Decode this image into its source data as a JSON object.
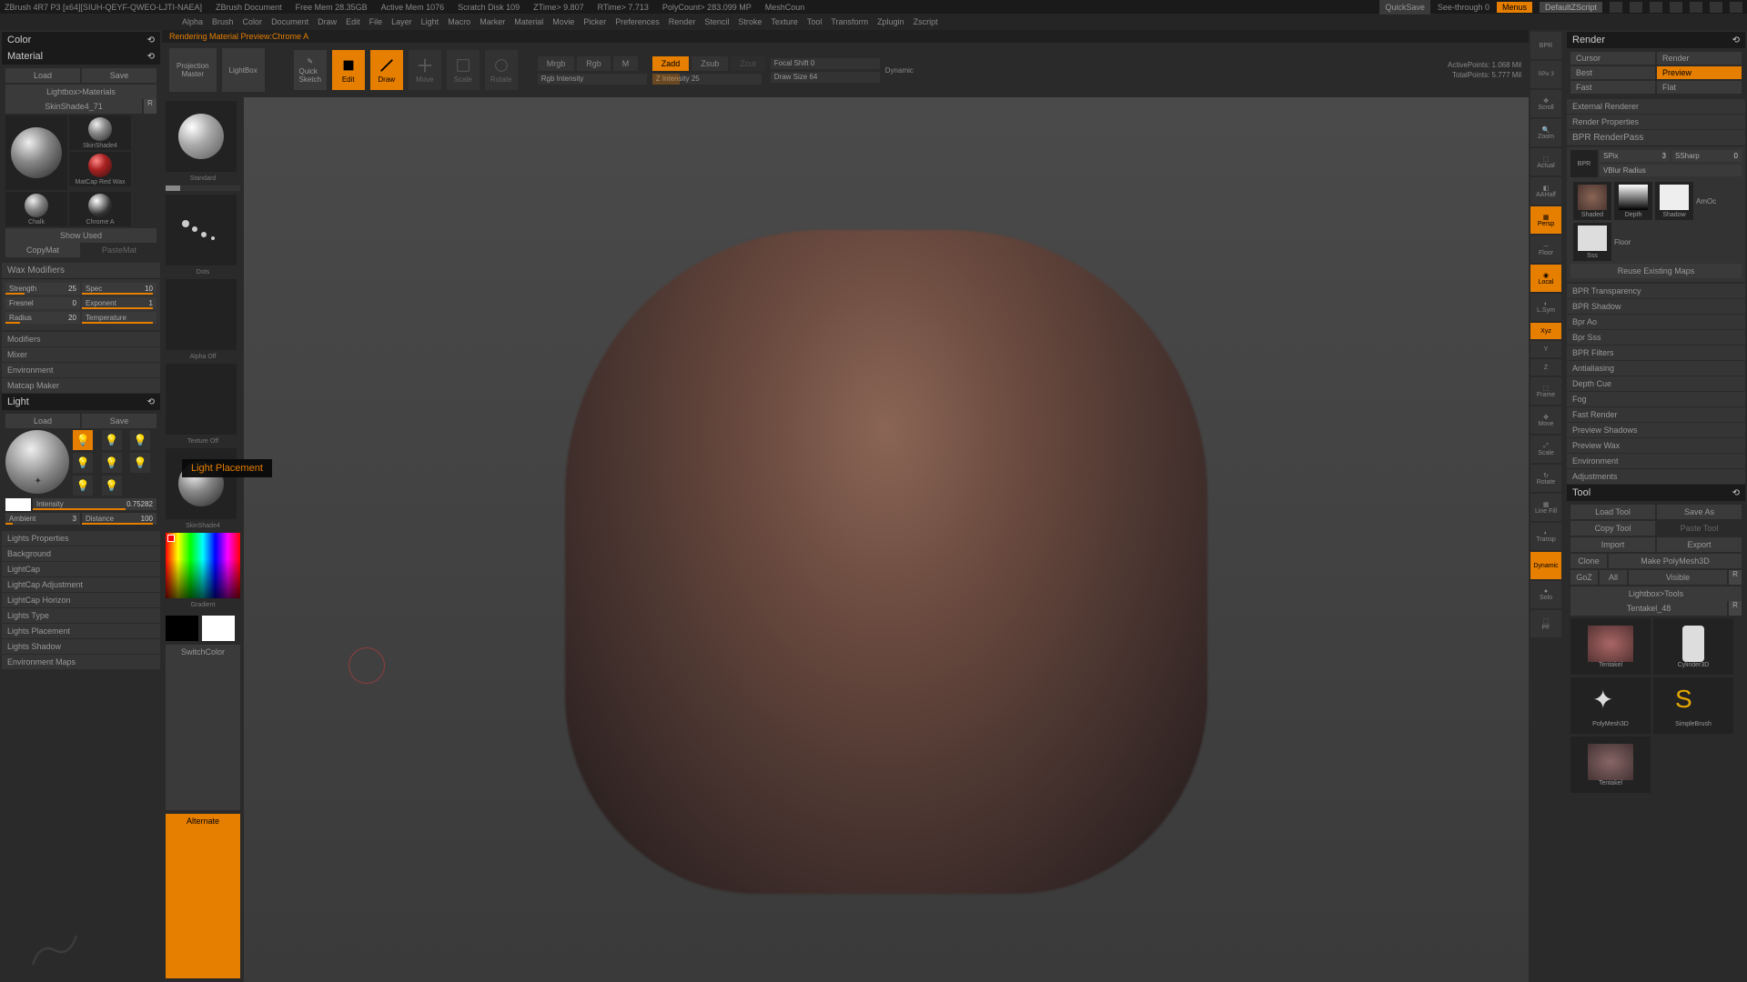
{
  "titlebar": {
    "app": "ZBrush 4R7 P3 [x64][SIUH-QEYF-QWEO-LJTI-NAEA]",
    "doc": "ZBrush Document",
    "mem_free": "Free Mem 28.35GB",
    "mem_active": "Active Mem 1076",
    "scratch": "Scratch Disk 109",
    "ztime": "ZTime> 9.807",
    "rtime": "RTime> 7.713",
    "polycount": "PolyCount> 283.099 MP",
    "meshcount": "MeshCoun",
    "quicksave": "QuickSave",
    "seethrough": "See-through 0",
    "menus": "Menus",
    "defscript": "DefaultZScript"
  },
  "menubar": [
    "Alpha",
    "Brush",
    "Color",
    "Document",
    "Draw",
    "Edit",
    "File",
    "Layer",
    "Light",
    "Macro",
    "Marker",
    "Material",
    "Movie",
    "Picker",
    "Preferences",
    "Render",
    "Stencil",
    "Stroke",
    "Texture",
    "Tool",
    "Transform",
    "Zplugin",
    "Zscript"
  ],
  "left": {
    "color_title": "Color",
    "material_title": "Material",
    "load": "Load",
    "save": "Save",
    "lightbox_mat": "Lightbox>Materials",
    "skinshade": "SkinShade4_71",
    "mat_labels": {
      "skin": "SkinShade4",
      "redwax": "MatCap Red Wax",
      "chalk": "Chalk",
      "chrome": "Chrome A"
    },
    "show_used": "Show Used",
    "copymat": "CopyMat",
    "pastemat": "PasteMat",
    "wax": {
      "title": "Wax Modifiers",
      "strength_l": "Strength",
      "strength_v": "25",
      "spec_l": "Spec",
      "spec_v": "10",
      "fresnel_l": "Fresnel",
      "fresnel_v": "0",
      "exponent_l": "Exponent",
      "exponent_v": "1",
      "radius_l": "Radius",
      "radius_v": "20",
      "temp_l": "Temperature",
      "temp_v": ""
    },
    "modifiers": "Modifiers",
    "mixer": "Mixer",
    "environment": "Environment",
    "matcap": "Matcap Maker",
    "light_title": "Light",
    "intensity_l": "Intensity",
    "intensity_v": "0.75282",
    "ambient_l": "Ambient",
    "ambient_v": "3",
    "distance_l": "Distance",
    "distance_v": "100",
    "light_props": "Lights Properties",
    "background": "Background",
    "lightcap": "LightCap",
    "lightcap_adj": "LightCap Adjustment",
    "lightcap_hor": "LightCap Horizon",
    "lights_type": "Lights Type",
    "lights_placement": "Lights Placement",
    "lights_shadow": "Lights Shadow",
    "env_maps": "Environment Maps"
  },
  "toolbar": {
    "proj_master": "Projection\nMaster",
    "lightbox": "LightBox",
    "quick_sketch": "Quick\nSketch",
    "edit": "Edit",
    "draw": "Draw",
    "move": "Move",
    "scale": "Scale",
    "rotate": "Rotate",
    "mrgb": "Mrgb",
    "rgb": "Rgb",
    "m": "M",
    "rgb_int": "Rgb Intensity",
    "zadd": "Zadd",
    "zsub": "Zsub",
    "zcut": "Zcut",
    "z_int": "Z Intensity",
    "z_int_v": "25",
    "focal": "Focal Shift",
    "focal_v": "0",
    "draw_size": "Draw Size",
    "draw_size_v": "64",
    "dynamic": "Dynamic",
    "active_pts": "ActivePoints:",
    "active_pts_v": "1.068 Mil",
    "total_pts": "TotalPoints:",
    "total_pts_v": "5.777 Mil"
  },
  "status": "Rendering Material Preview:Chrome A",
  "tooltip": "Light Placement",
  "dock": {
    "standard": "Standard",
    "dots": "Dots",
    "alpha": "Alpha Off",
    "texture": "Texture Off",
    "skinshade": "SkinShade4",
    "switchcolor": "SwitchColor",
    "alternate": "Alternate",
    "gradient": "Gradient"
  },
  "sidebar": {
    "bpr": "BPR",
    "spix": "SPix 3",
    "scroll": "Scroll",
    "zoom": "Zoom",
    "actual": "Actual",
    "aahalf": "AAHalf",
    "persp": "Persp",
    "floor": "Floor",
    "local": "Local",
    "lsym": "L.Sym",
    "xyz": "Xyz",
    "frame": "Frame",
    "move": "Move",
    "scale": "Scale",
    "rotate": "Rotate",
    "linefill": "Line Fill",
    "transp": "Transp",
    "dynamic": "Dynamic",
    "solo": "Solo",
    "pf": "PF"
  },
  "render": {
    "title": "Render",
    "cursor": "Cursor",
    "render": "Render",
    "best": "Best",
    "preview": "Preview",
    "fast": "Fast",
    "flat": "Flat",
    "external": "External Renderer",
    "props": "Render Properties",
    "bpr_pass": "BPR RenderPass",
    "spix": "SPix",
    "spix_v": "3",
    "ssharp": "SSharp",
    "ssharp_v": "0",
    "vblur": "VBlur Radius",
    "shaded": "Shaded",
    "depth": "Depth",
    "shadow": "Shadow",
    "amoc": "AmOc",
    "sss": "Sss",
    "floor_p": "Floor",
    "reuse": "Reuse Existing Maps",
    "items": [
      "BPR Transparency",
      "BPR Shadow",
      "Bpr Ao",
      "Bpr Sss",
      "BPR Filters",
      "Antialiasing",
      "Depth Cue",
      "Fog",
      "Fast Render",
      "Preview Shadows",
      "Preview Wax",
      "Environment",
      "Adjustments"
    ]
  },
  "tool": {
    "title": "Tool",
    "load": "Load Tool",
    "saveas": "Save As",
    "copy": "Copy Tool",
    "paste": "Paste Tool",
    "import": "Import",
    "export": "Export",
    "clone": "Clone",
    "make": "Make PolyMesh3D",
    "goz": "GoZ",
    "all": "All",
    "visible": "Visible",
    "lightbox": "Lightbox>Tools",
    "name": "Tentakel_48",
    "thumbs": {
      "tentakel": "Tentakel",
      "cyl": "Cylinder3D",
      "poly": "PolyMesh3D",
      "simple": "SimpleBrush",
      "t2": "Tentakel"
    }
  }
}
